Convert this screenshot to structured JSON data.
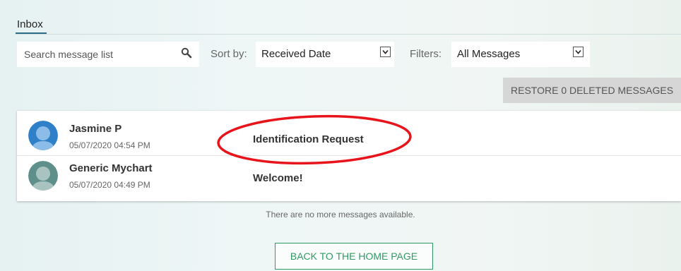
{
  "tabs": {
    "inbox_label": "Inbox"
  },
  "toolbar": {
    "search_placeholder": "Search message list",
    "search_icon": "search-icon",
    "sort_label": "Sort by:",
    "sort_value": "Received Date",
    "filter_label": "Filters:",
    "filter_value": "All Messages"
  },
  "restore_button": {
    "label": "RESTORE 0 DELETED MESSAGES"
  },
  "messages": [
    {
      "sender": "Jasmine P",
      "timestamp": "05/07/2020 04:54 PM",
      "subject": "Identification Request",
      "avatar_color": "#2f80c8",
      "highlighted": true
    },
    {
      "sender": "Generic Mychart",
      "timestamp": "05/07/2020 04:49 PM",
      "subject": "Welcome!",
      "avatar_color": "#5f8f8a",
      "highlighted": false
    }
  ],
  "footer": {
    "no_more_text": "There are no more messages available.",
    "home_button_label": "BACK TO THE HOME PAGE"
  },
  "colors": {
    "accent_green": "#2f9a64",
    "tab_underline": "#2d6d88",
    "highlight_red": "#e8141c"
  }
}
